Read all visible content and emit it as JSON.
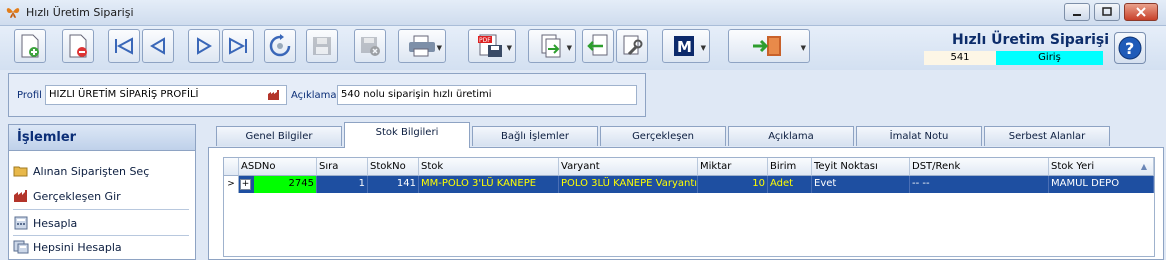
{
  "window": {
    "title": "Hızlı Üretim Siparişi"
  },
  "header": {
    "form_title": "Hızlı Üretim Siparişi",
    "code": "541",
    "status": "Giriş",
    "status_color": "#00ffff"
  },
  "profile": {
    "profile_label": "Profil",
    "profile_value": "HIZLI ÜRETİM SİPARİŞ PROFİLİ",
    "description_label": "Açıklama",
    "description_value": "540 nolu siparişin hızlı üretimi"
  },
  "operations": {
    "title": "İşlemler",
    "items": [
      {
        "label": "Alınan Siparişten Seç",
        "icon": "folder-open-icon"
      },
      {
        "label": "Gerçekleşen Gir",
        "icon": "factory-icon"
      },
      {
        "label": "Hesapla",
        "icon": "calculator-icon"
      },
      {
        "label": "Hepsini Hesapla",
        "icon": "calculator-all-icon"
      }
    ]
  },
  "tabs": [
    {
      "label": "Genel Bilgiler"
    },
    {
      "label": "Stok Bilgileri",
      "active": true
    },
    {
      "label": "Bağlı İşlemler"
    },
    {
      "label": "Gerçekleşen"
    },
    {
      "label": "Açıklama"
    },
    {
      "label": "İmalat Notu"
    },
    {
      "label": "Serbest Alanlar"
    }
  ],
  "grid": {
    "columns": [
      "ASDNo",
      "Sıra",
      "StokNo",
      "Stok",
      "Varyant",
      "Miktar",
      "Birim",
      "Teyit Noktası",
      "DST/Renk",
      "Stok Yeri"
    ],
    "rows": [
      {
        "indicator": ">",
        "expand": "+",
        "asdno": "2745",
        "sira": "1",
        "stokno": "141",
        "stok": "MM-POLO 3'LÜ KANEPE",
        "varyant": "POLO 3LÜ KANEPE Varyantı",
        "miktar": "10",
        "birim": "Adet",
        "teyit": "Evet",
        "dst": "-- --",
        "stok_yeri": "MAMUL DEPO"
      }
    ]
  }
}
